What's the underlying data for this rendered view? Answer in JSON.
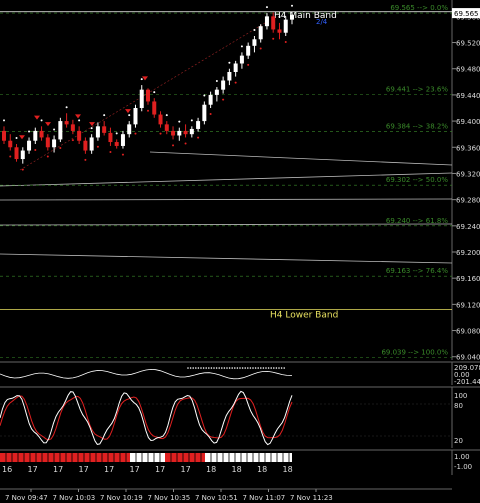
{
  "symbol_price_box": "69.565",
  "price_scale": [
    "69.560",
    "69.520",
    "69.480",
    "69.440",
    "69.400",
    "69.360",
    "69.320",
    "69.280",
    "69.240",
    "69.200",
    "69.160",
    "69.120",
    "69.080",
    "69.040"
  ],
  "fib_levels": [
    {
      "label": "69.565 --> 0.0%",
      "value": 69.565
    },
    {
      "label": "69.441 --> 23.6%",
      "value": 69.441
    },
    {
      "label": "69.384 --> 38.2%",
      "value": 69.384
    },
    {
      "label": "69.302 --> 50.0%",
      "value": 69.302
    },
    {
      "label": "69.240 --> 61.8%",
      "value": 69.24
    },
    {
      "label": "69.163 --> 76.4%",
      "value": 69.163
    },
    {
      "label": "69.039 --> 100.0%",
      "value": 69.039
    }
  ],
  "bands": {
    "main": {
      "label": "H4 Main Band",
      "value": 69.567
    },
    "lower": {
      "label": "H4 Lower Band",
      "value": 69.112
    },
    "small_label": "2/4"
  },
  "price_range": {
    "max": 69.585,
    "min": 69.035
  },
  "indicator1": {
    "values": [
      "209.0781",
      "0.00",
      "-201.441"
    ]
  },
  "indicator2": {
    "levels": [
      "100",
      "80",
      "20"
    ]
  },
  "indicator3": {
    "levels": [
      "1.00",
      "-1.00"
    ]
  },
  "bottom_hour_labels": [
    "16",
    "17",
    "17",
    "17",
    "17",
    "17",
    "17",
    "17",
    "18",
    "18",
    "18",
    "18"
  ],
  "time_axis": [
    "7 Nov 09:47",
    "7 Nov 10:03",
    "7 Nov 10:19",
    "7 Nov 10:35",
    "7 Nov 10:51",
    "7 Nov 11:07",
    "7 Nov 11:23"
  ],
  "colors": {
    "background": "#000000",
    "fib": "#3a8a2a",
    "band_main": "#ffffff",
    "band_lower": "#e8e060",
    "up_candle": "#ffffff",
    "down_candle": "#e02020",
    "stoch_main": "#ffffff",
    "stoch_signal": "#e02020",
    "dots_up": "#ffffff",
    "dots_down": "#e02020",
    "segment_red": "#e02020",
    "segment_white": "#ffffff"
  },
  "chart_data": {
    "type": "candlestick",
    "candles": [
      [
        69.385,
        69.392,
        69.365,
        69.37
      ],
      [
        69.37,
        69.38,
        69.355,
        69.36
      ],
      [
        69.36,
        69.365,
        69.338,
        69.342
      ],
      [
        69.342,
        69.36,
        69.335,
        69.355
      ],
      [
        69.355,
        69.375,
        69.35,
        69.37
      ],
      [
        69.37,
        69.39,
        69.365,
        69.385
      ],
      [
        69.385,
        69.392,
        69.37,
        69.375
      ],
      [
        69.375,
        69.38,
        69.355,
        69.36
      ],
      [
        69.36,
        69.378,
        69.352,
        69.372
      ],
      [
        69.372,
        69.405,
        69.368,
        69.4
      ],
      [
        69.4,
        69.412,
        69.39,
        69.395
      ],
      [
        69.395,
        69.402,
        69.38,
        69.385
      ],
      [
        69.385,
        69.392,
        69.365,
        69.37
      ],
      [
        69.37,
        69.375,
        69.35,
        69.355
      ],
      [
        69.355,
        69.38,
        69.35,
        69.375
      ],
      [
        69.375,
        69.398,
        69.37,
        69.392
      ],
      [
        69.392,
        69.4,
        69.378,
        69.382
      ],
      [
        69.382,
        69.39,
        69.362,
        69.368
      ],
      [
        69.368,
        69.372,
        69.358,
        69.362
      ],
      [
        69.362,
        69.385,
        69.358,
        69.38
      ],
      [
        69.38,
        69.4,
        69.375,
        69.395
      ],
      [
        69.395,
        69.425,
        69.39,
        69.42
      ],
      [
        69.42,
        69.455,
        69.415,
        69.448
      ],
      [
        69.448,
        69.45,
        69.425,
        69.43
      ],
      [
        69.43,
        69.435,
        69.405,
        69.41
      ],
      [
        69.41,
        69.415,
        69.39,
        69.395
      ],
      [
        69.395,
        69.4,
        69.38,
        69.385
      ],
      [
        69.385,
        69.392,
        69.372,
        69.378
      ],
      [
        69.378,
        69.39,
        69.37,
        69.385
      ],
      [
        69.385,
        69.395,
        69.375,
        69.38
      ],
      [
        69.38,
        69.392,
        69.375,
        69.388
      ],
      [
        69.388,
        69.405,
        69.384,
        69.4
      ],
      [
        69.4,
        69.43,
        69.395,
        69.425
      ],
      [
        69.425,
        69.445,
        69.42,
        69.44
      ],
      [
        69.44,
        69.452,
        69.43,
        69.448
      ],
      [
        69.448,
        69.468,
        69.442,
        69.462
      ],
      [
        69.462,
        69.48,
        69.455,
        69.475
      ],
      [
        69.475,
        69.492,
        69.468,
        69.488
      ],
      [
        69.488,
        69.505,
        69.48,
        69.5
      ],
      [
        69.5,
        69.52,
        69.495,
        69.515
      ],
      [
        69.515,
        69.53,
        69.505,
        69.525
      ],
      [
        69.525,
        69.548,
        69.52,
        69.545
      ],
      [
        69.545,
        69.565,
        69.54,
        69.56
      ],
      [
        69.56,
        69.566,
        69.535,
        69.54
      ],
      [
        69.54,
        69.55,
        69.525,
        69.535
      ],
      [
        69.535,
        69.56,
        69.53,
        69.555
      ],
      [
        69.555,
        69.567,
        69.548,
        69.562
      ]
    ]
  }
}
